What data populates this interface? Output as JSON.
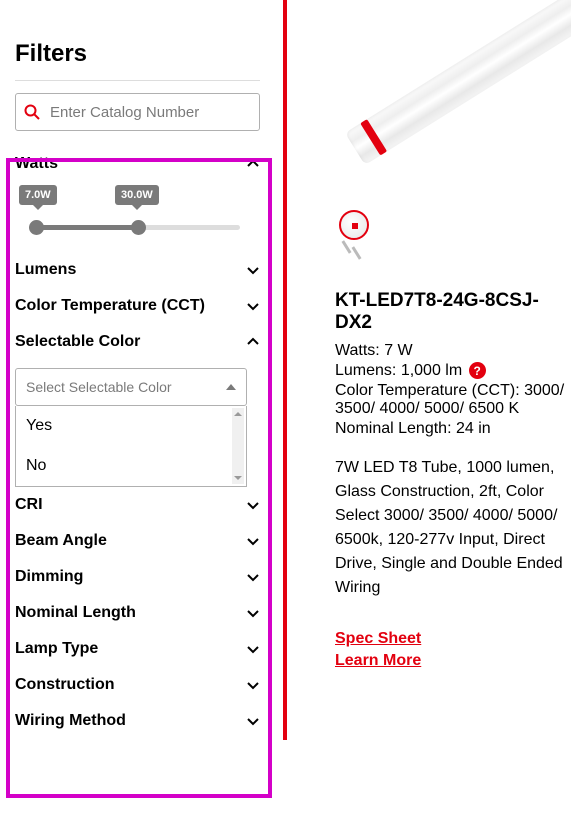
{
  "filters": {
    "title": "Filters",
    "search_placeholder": "Enter Catalog Number",
    "sections": {
      "watts": {
        "label": "Watts",
        "min_label": "7.0W",
        "max_label": "30.0W"
      },
      "lumens": {
        "label": "Lumens"
      },
      "cct": {
        "label": "Color Temperature (CCT)"
      },
      "selectable_color": {
        "label": "Selectable Color",
        "placeholder": "Select Selectable Color",
        "options": {
          "yes": "Yes",
          "no": "No"
        }
      },
      "cri": {
        "label": "CRI"
      },
      "beam_angle": {
        "label": "Beam Angle"
      },
      "dimming": {
        "label": "Dimming"
      },
      "nominal_length": {
        "label": "Nominal Length"
      },
      "lamp_type": {
        "label": "Lamp Type"
      },
      "construction": {
        "label": "Construction"
      },
      "wiring_method": {
        "label": "Wiring Method"
      }
    }
  },
  "product": {
    "sku": "KT-LED7T8-24G-8CSJ-DX2",
    "watts_label": "Watts: ",
    "watts_value": "7 W",
    "lumens_label": "Lumens: ",
    "lumens_value": "1,000 lm",
    "cct_label": "Color Temperature (CCT): ",
    "cct_value": "3000/ 3500/ 4000/ 5000/ 6500 K",
    "length_label": "Nominal Length: ",
    "length_value": "24 in",
    "description": "7W LED T8 Tube, 1000 lumen, Glass Construction, 2ft, Color Select 3000/ 3500/ 4000/ 5000/ 6500k, 120-277v Input, Direct Drive, Single and Double Ended Wiring",
    "links": {
      "spec_sheet": "Spec Sheet",
      "learn_more": "Learn More"
    }
  }
}
